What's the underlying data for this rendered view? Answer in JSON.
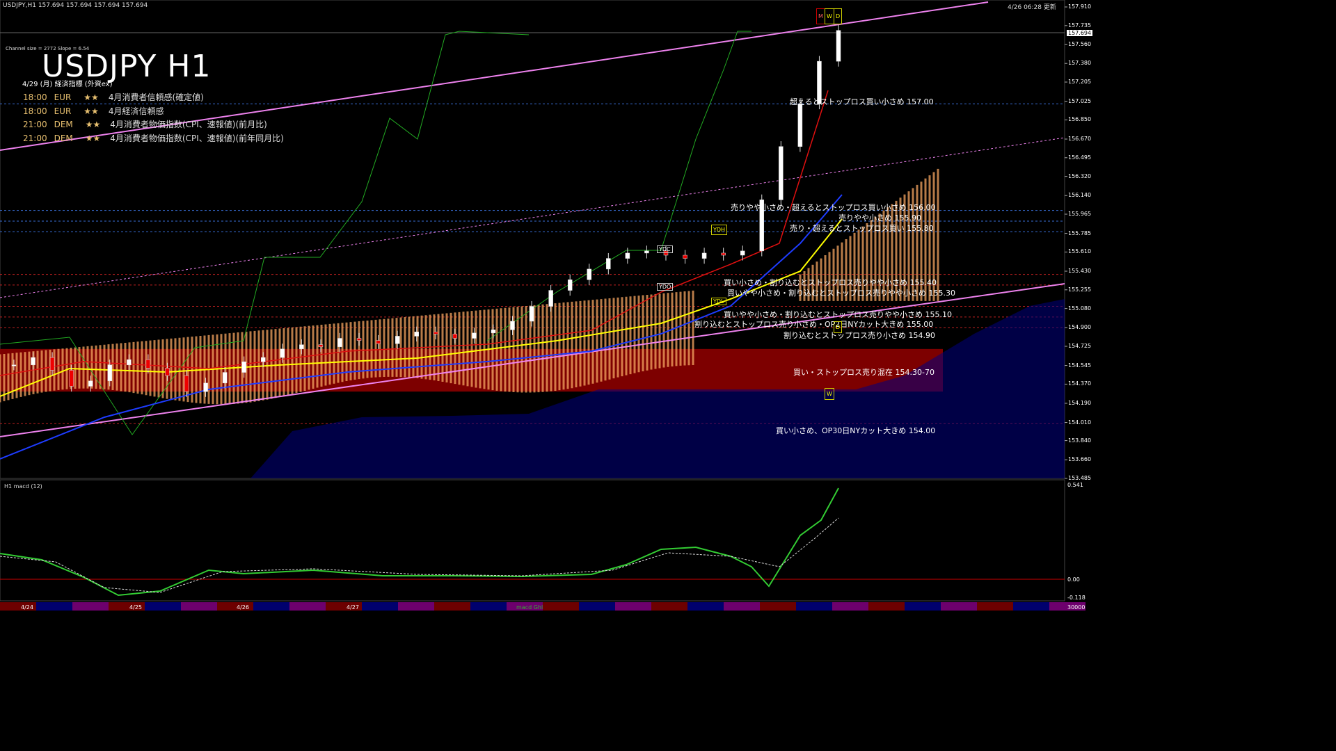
{
  "header": {
    "symbol_info": "USDJPY,H1  157.694 157.694 157.694 157.694",
    "timestamp": "4/26 06:28 更新",
    "channel_info": "Channel size = 2772 Slope = 6.54",
    "big_title": "USDJPY H1",
    "events_date": "4/29 (月) 経済指標 (外資ex)"
  },
  "events": [
    {
      "time": "18:00",
      "ccy": "EUR",
      "stars": "★★",
      "desc": "4月消費者信頼感(確定値)"
    },
    {
      "time": "18:00",
      "ccy": "EUR",
      "stars": "★★",
      "desc": "4月経済信頼感"
    },
    {
      "time": "21:00",
      "ccy": "DEM",
      "stars": "★★",
      "desc": "4月消費者物価指数(CPI、速報値)(前月比)"
    },
    {
      "time": "21:00",
      "ccy": "DEM",
      "stars": "★★",
      "desc": "4月消費者物価指数(CPI、速報値)(前年同月比)"
    }
  ],
  "levels": [
    {
      "label": "超えるとストップロス買い小さめ 157.00"
    },
    {
      "label": "売りやや小さめ・超えるとストップロス買い小さめ 156.00"
    },
    {
      "label": "売りやや小さめ 155.90"
    },
    {
      "label": "売り・超えるとストップロス買い 155.80"
    },
    {
      "label": "買い小さめ・割り込むとストップロス売りやや小さめ 155.40"
    },
    {
      "label": "買いやや小さめ・割り込むとストップロス売りやや小さめ 155.30"
    },
    {
      "label": "買いやや小さめ・割り込むとストップロス売りやや小さめ 155.10"
    },
    {
      "label": "割り込むとストップロス売り小さめ・OP2日NYカット大きめ 155.00"
    },
    {
      "label": "割り込むとストップロス売り小さめ 154.90"
    },
    {
      "label": "買い・ストップロス売り混在 154.30-70"
    },
    {
      "label": "買い小さめ、OP30日NYカット大きめ 154.00"
    }
  ],
  "markers": {
    "ydc": "YDC",
    "ydh": "YDH",
    "ydl": "YDL",
    "ydo": "YDO",
    "m": "M",
    "w": "W",
    "d": "D",
    "w2": "W",
    "d2": "D"
  },
  "macd": {
    "label": "H1  macd (12)",
    "top": "0.541",
    "zero": "0.00",
    "bottom": "-0.118"
  },
  "bottom_tab": "macd Ghl",
  "volume_label": "30000",
  "current_price": "157.694",
  "colors": {
    "bg": "#000000",
    "ichimoku_up": "#f4a460",
    "ichimoku_down": "#000080",
    "cloud_zone": "#8b0000",
    "channel": "#ee82ee",
    "ma_yellow": "#ffff00",
    "ma_blue": "#1e3cff",
    "chikou": "#22aa22"
  },
  "chart_data": {
    "type": "line",
    "title": "USDJPY H1",
    "xlabel": "",
    "ylabel": "",
    "x_ticks": [
      "4/24",
      "4/25",
      "4/26",
      "4/27"
    ],
    "y_ticks": [
      "157.910",
      "157.735",
      "157.560",
      "157.380",
      "157.205",
      "157.025",
      "156.850",
      "156.670",
      "156.495",
      "156.320",
      "156.140",
      "155.965",
      "155.785",
      "155.610",
      "155.430",
      "155.255",
      "155.080",
      "154.900",
      "154.725",
      "154.545",
      "154.370",
      "154.190",
      "154.010",
      "153.840",
      "153.660",
      "153.485"
    ],
    "ylim": [
      153.485,
      157.91
    ],
    "grid": false,
    "series": [
      {
        "name": "close",
        "values": [
          154.55,
          154.62,
          154.5,
          154.35,
          154.4,
          154.55,
          154.6,
          154.52,
          154.45,
          154.3,
          154.38,
          154.48,
          154.58,
          154.62,
          154.7,
          154.74,
          154.72,
          154.8,
          154.78,
          154.75,
          154.82,
          154.86,
          154.84,
          154.8,
          154.85,
          154.88,
          154.96,
          155.1,
          155.25,
          155.35,
          155.45,
          155.55,
          155.6,
          155.62,
          155.58,
          155.55,
          155.6,
          155.58,
          155.62,
          156.1,
          156.6,
          157.0,
          157.4,
          157.69
        ]
      }
    ]
  }
}
